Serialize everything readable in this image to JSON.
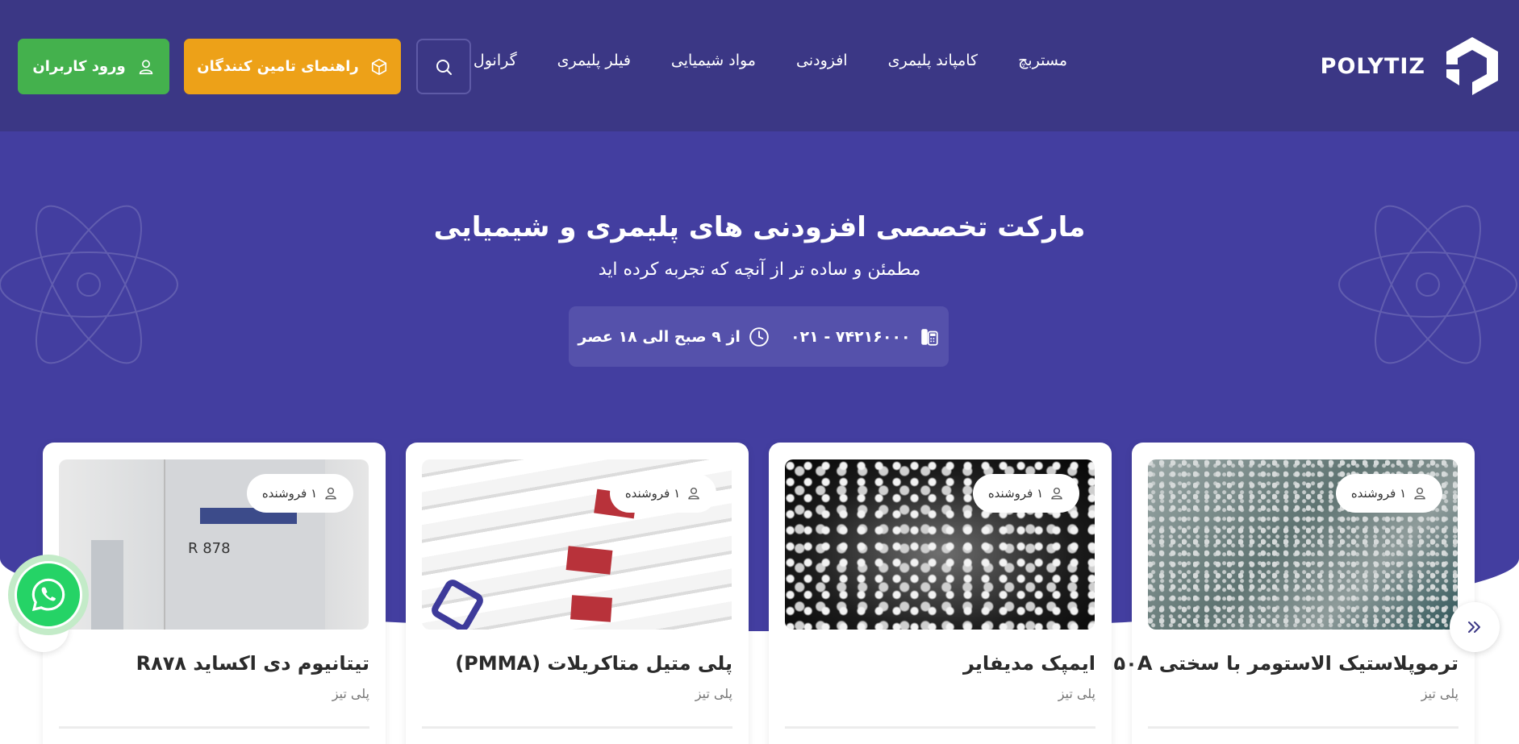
{
  "header": {
    "logo_text": "POLYTIZ",
    "nav": [
      "مستربچ",
      "کامپاند پلیمری",
      "افزودنی",
      "مواد شیمیایی",
      "فیلر پلیمری",
      "گرانول"
    ],
    "supplier_guide_label": "راهنمای تامین کنندگان",
    "login_label": "ورود کاربران"
  },
  "hero": {
    "title": "مارکت تخصصی افزودنی های پلیمری و شیمیایی",
    "subtitle": "مطمئن و ساده تر از آنچه که تجربه کرده اید",
    "phone": "۰۲۱ - ۷۴۲۱۶۰۰۰",
    "hours": "از ۹ صبح الی ۱۸ عصر"
  },
  "products": [
    {
      "title": "ترموپلاستیک الاستومر با سختی ۵۰A",
      "brand": "پلی تیز",
      "vendors": "۱ فروشنده",
      "image": "clear-granules-on-teal"
    },
    {
      "title": "ایمپک مدیفایر",
      "brand": "پلی تیز",
      "vendors": "۱ فروشنده",
      "image": "transparent-pellets-on-black"
    },
    {
      "title": "پلی متیل متاکریلات (PMMA)",
      "brand": "پلی تیز",
      "vendors": "۱ فروشنده",
      "image": "pmma-bags"
    },
    {
      "title": "تیتانیوم دی اکساید R۸۷۸",
      "brand": "پلی تیز",
      "vendors": "۱ فروشنده",
      "image": "titanium-dioxide-bags"
    }
  ],
  "colors": {
    "header_bg": "#3b3785",
    "hero_bg": "#433ea0",
    "supplier_btn": "#eda118",
    "login_btn": "#44b14d",
    "whatsapp": "#25d366"
  },
  "icons": [
    "polytiz-logo-icon",
    "search-icon",
    "box-icon",
    "user-icon",
    "phone-icon",
    "clock-icon",
    "double-chevron-right-icon",
    "whatsapp-icon"
  ]
}
